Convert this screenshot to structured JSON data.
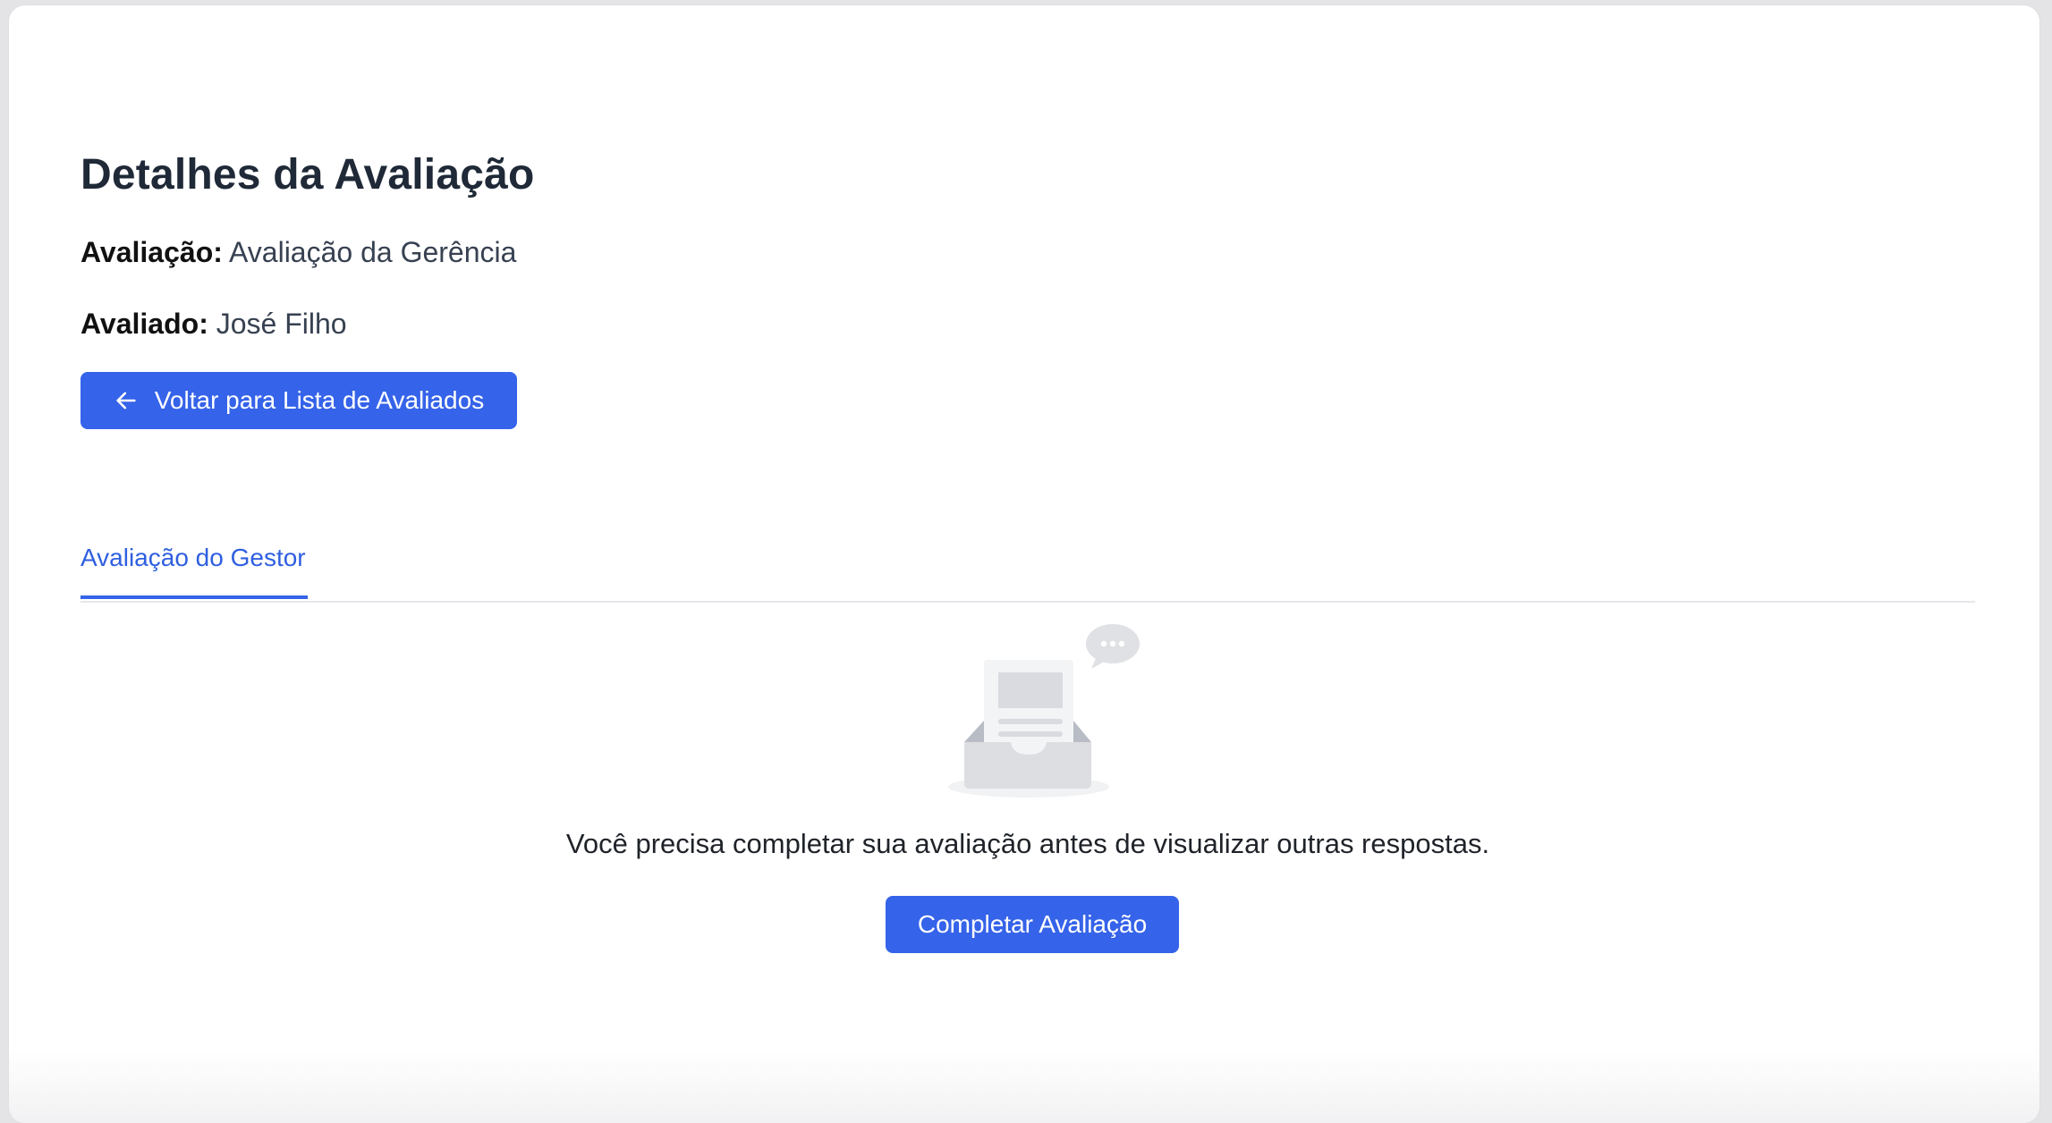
{
  "page": {
    "title": "Detalhes da Avaliação"
  },
  "details": {
    "evaluation_label": "Avaliação:",
    "evaluation_value": "Avaliação da Gerência",
    "evaluated_label": "Avaliado:",
    "evaluated_value": "José Filho"
  },
  "back_button": {
    "label": "Voltar para Lista de Avaliados",
    "icon": "arrow-left-icon"
  },
  "tabs": [
    {
      "label": "Avaliação do Gestor",
      "active": true
    }
  ],
  "empty_state": {
    "icon": "empty-inbox-illustration",
    "message": "Você precisa completar sua avaliação antes de visualizar outras respostas.",
    "action_label": "Completar Avaliação"
  },
  "colors": {
    "primary": "#3563e9",
    "tab_active": "#2f5fe0",
    "heading": "#1f2937"
  }
}
